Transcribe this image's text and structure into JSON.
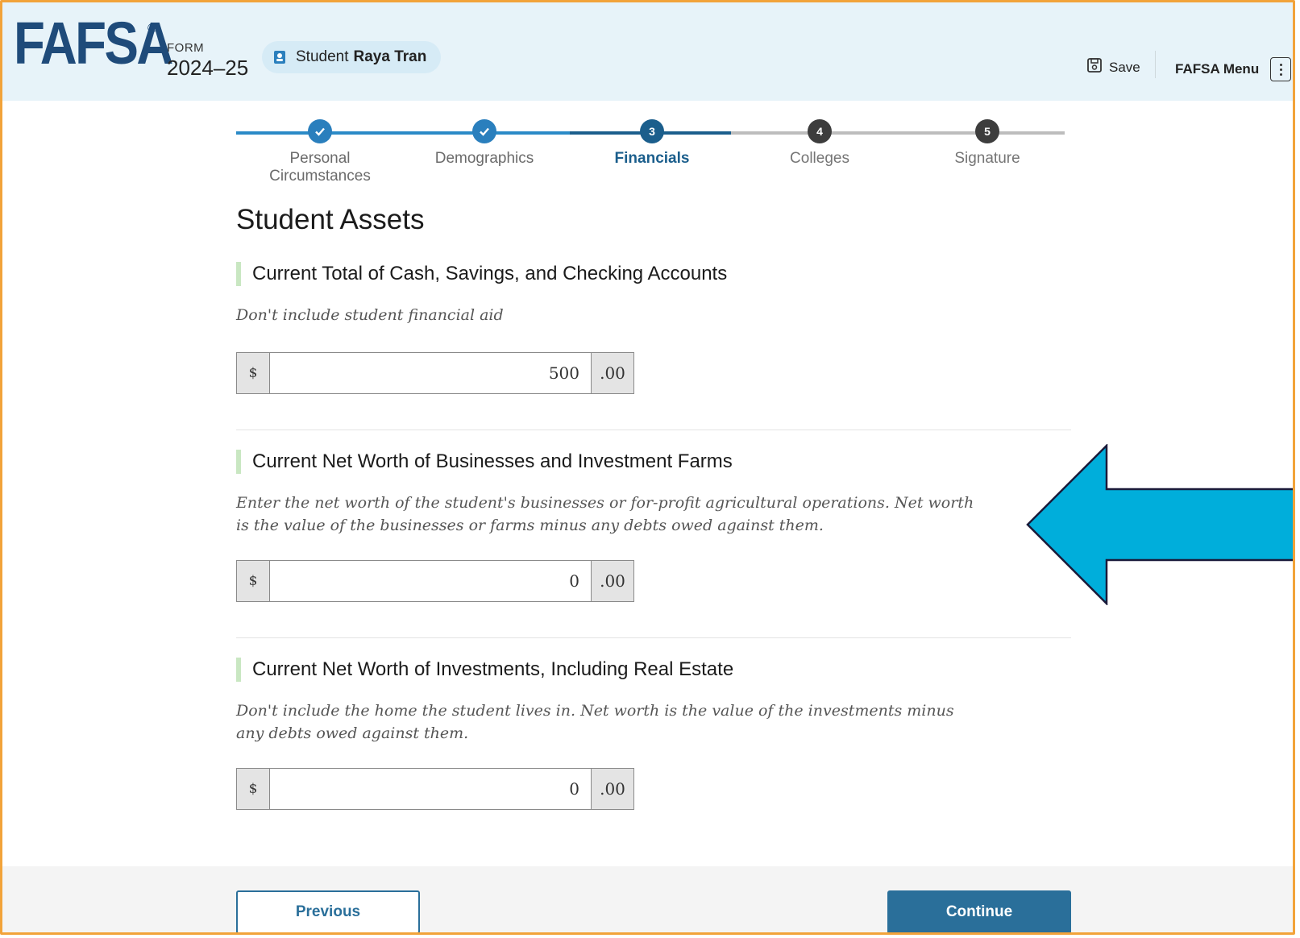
{
  "header": {
    "logo": "FAFSA",
    "reg_mark": "®",
    "form_label": "FORM",
    "form_year": "2024–25",
    "student_prefix": "Student",
    "student_name": "Raya Tran",
    "save_label": "Save",
    "menu_label": "FAFSA Menu"
  },
  "progress": {
    "steps": [
      {
        "number": "1",
        "label": "Personal Circumstances",
        "status": "done"
      },
      {
        "number": "2",
        "label": "Demographics",
        "status": "done"
      },
      {
        "number": "3",
        "label": "Financials",
        "status": "current"
      },
      {
        "number": "4",
        "label": "Colleges",
        "status": "todo"
      },
      {
        "number": "5",
        "label": "Signature",
        "status": "todo"
      }
    ]
  },
  "page": {
    "title": "Student Assets"
  },
  "questions": [
    {
      "title": "Current Total of Cash, Savings, and Checking Accounts",
      "hint": "Don't include student financial aid",
      "prefix": "$",
      "value": "500",
      "suffix": ".00"
    },
    {
      "title": "Current Net Worth of Businesses and Investment Farms",
      "hint": "Enter the net worth of the student's businesses or for-profit agricultural operations. Net worth is the value of the businesses or farms minus any debts owed against them.",
      "prefix": "$",
      "value": "0",
      "suffix": ".00"
    },
    {
      "title": "Current Net Worth of Investments, Including Real Estate",
      "hint": "Don't include the home the student lives in. Net worth is the value of the investments minus any debts owed against them.",
      "prefix": "$",
      "value": "0",
      "suffix": ".00"
    }
  ],
  "footer": {
    "previous_label": "Previous",
    "continue_label": "Continue"
  },
  "colors": {
    "frame_border": "#f2a33a",
    "header_bg": "#e7f3f9",
    "brand_blue": "#1f4b7a",
    "primary_button": "#2a6f9a",
    "annotation_arrow": "#00aedb"
  },
  "icons": {
    "student": "student-badge-icon",
    "save": "save-disk-icon",
    "menu": "kebab-menu-icon",
    "step_done": "checkmark-icon",
    "annotation": "left-arrow-annotation"
  }
}
